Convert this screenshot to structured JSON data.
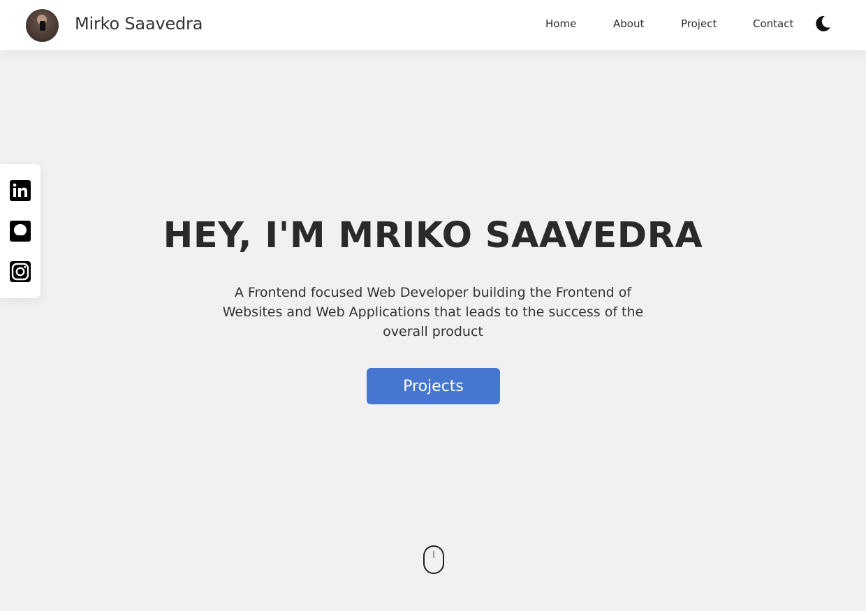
{
  "header": {
    "brand_name": "Mirko Saavedra",
    "nav": [
      {
        "label": "Home"
      },
      {
        "label": "About"
      },
      {
        "label": "Project"
      },
      {
        "label": "Contact"
      }
    ],
    "theme_icon": "moon-icon"
  },
  "social": [
    {
      "icon": "linkedin-icon"
    },
    {
      "icon": "github-icon"
    },
    {
      "icon": "instagram-icon"
    }
  ],
  "hero": {
    "title": "HEY, I'M MRIKO SAAVEDRA",
    "subtitle": "A Frontend focused Web Developer building the Frontend of Websites and Web Applications that leads to the success of the overall product",
    "cta_label": "Projects"
  },
  "colors": {
    "background": "#f1f1f1",
    "header_bg": "#ffffff",
    "accent": "#4676cf",
    "text": "#2a2a2a"
  },
  "scroll_icon": "mouse-scroll-icon"
}
